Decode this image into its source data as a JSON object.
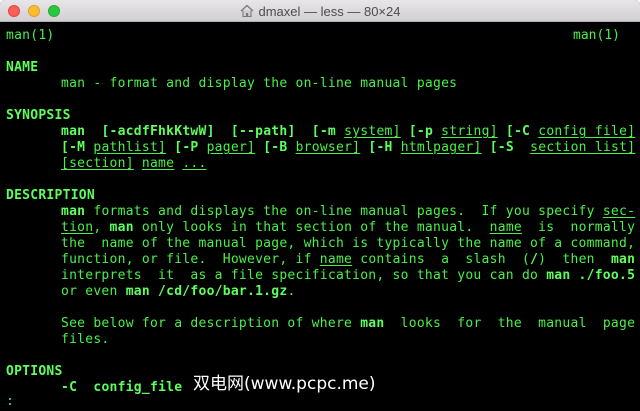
{
  "window": {
    "title": "dmaxel — less — 80×24"
  },
  "man": {
    "header_left": "man(1)",
    "header_right": "man(1)",
    "name_heading": "NAME",
    "name_text": "man - format and display the on-line manual pages",
    "synopsis_heading": "SYNOPSIS",
    "syn": {
      "l1a": "man",
      "l1b": "[-acdfFhkKtwW]",
      "l1c": "[--path]",
      "l1d": "[-m",
      "l1e": "system]",
      "l1f": "[-p",
      "l1g": "string]",
      "l1h": "[-C",
      "l1i": "config_file]",
      "l2a": "[-M",
      "l2b": "pathlist]",
      "l2c": "[-P",
      "l2d": "pager]",
      "l2e": "[-B",
      "l2f": "browser]",
      "l2g": "[-H",
      "l2h": "htmlpager]",
      "l2i": "[-S",
      "l2j": "section_list]",
      "l3a": "[section]",
      "l3b": "name",
      "l3c": "..."
    },
    "description_heading": "DESCRIPTION",
    "desc": {
      "l1a": "man",
      "l1b": " formats and displays the on-line manual pages.  If you specify ",
      "l1c": "sec-",
      "l2a": "tion",
      "l2b": ", ",
      "l2c": "man",
      "l2d": " only looks in that section of the manual.  ",
      "l2e": "name",
      "l2f": "  is  normally",
      "l3": "the  name of the manual page, which is typically the name of a command,",
      "l4a": "function, or file.  However, if ",
      "l4b": "name",
      "l4c": " contains  a  slash  (",
      "l4d": "/",
      "l4e": ")  then  ",
      "l4f": "man",
      "l5": "interprets  it  as a file specification, so that you can do ",
      "l5b": "man ./foo.5",
      "l6a": "or even ",
      "l6b": "man /cd/foo/bar.1.gz",
      "l6c": ".",
      "l7a": "See below for a description of where ",
      "l7b": "man",
      "l7c": "  looks  for  the  manual  page",
      "l8": "files."
    },
    "options_heading": "OPTIONS",
    "opt": {
      "a": "-C",
      "b": "config_file"
    },
    "prompt": ":"
  },
  "watermark": "双电网(www.pcpc.me)",
  "colors": {
    "terminal_bg": "#000000",
    "terminal_fg": "#4af04a"
  }
}
